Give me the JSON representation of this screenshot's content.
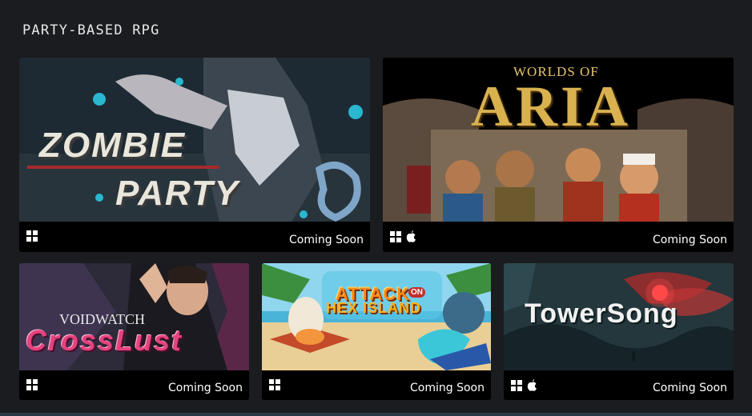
{
  "section": {
    "title": "PARTY-BASED RPG"
  },
  "games": [
    {
      "title_line1": "ZOMBIE",
      "title_line2": "PARTY",
      "status": "Coming Soon",
      "platforms": [
        "windows-icon"
      ]
    },
    {
      "title_small": "WORLDS OF",
      "title_big": "ARIA",
      "status": "Coming Soon",
      "platforms": [
        "windows-icon",
        "apple-icon"
      ]
    },
    {
      "title_small": "VOIDWATCH",
      "title_big": "CrossLust",
      "status": "Coming Soon",
      "platforms": [
        "windows-icon"
      ]
    },
    {
      "title_line1": "ATTACK",
      "title_badge": "ON",
      "title_line2": "HEX ISLAND",
      "status": "Coming Soon",
      "platforms": [
        "windows-icon"
      ]
    },
    {
      "title_big": "TowerSong",
      "status": "Coming Soon",
      "platforms": [
        "windows-icon",
        "apple-icon"
      ]
    }
  ],
  "colors": {
    "background": "#1b1c1f",
    "card_footer": "#000000",
    "text": "#ffffff"
  }
}
